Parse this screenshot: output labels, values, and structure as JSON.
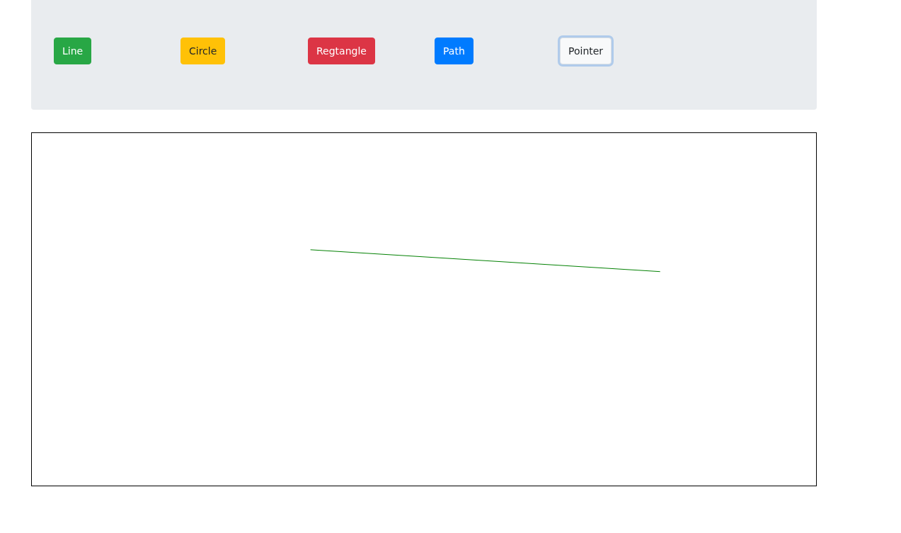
{
  "toolbar": {
    "buttons": [
      {
        "label": "Line",
        "color": "#28a745",
        "selected": false
      },
      {
        "label": "Circle",
        "color": "#ffc107",
        "selected": false
      },
      {
        "label": "Regtangle",
        "color": "#dc3545",
        "selected": false
      },
      {
        "label": "Path",
        "color": "#007bff",
        "selected": false
      },
      {
        "label": "Pointer",
        "color": "#f8f9fa",
        "selected": true
      }
    ]
  },
  "canvas": {
    "shapes": [
      {
        "kind": "line",
        "color": "#008000"
      }
    ]
  }
}
